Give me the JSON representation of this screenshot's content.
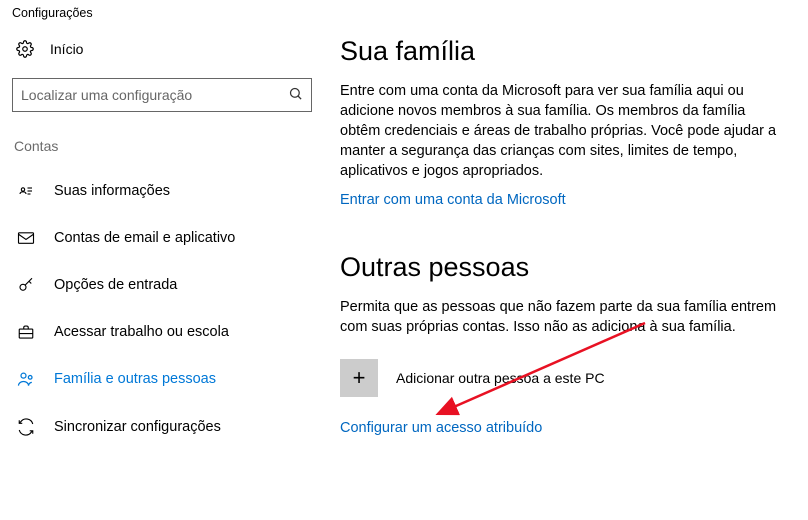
{
  "window": {
    "title": "Configurações"
  },
  "sidebar": {
    "home_label": "Início",
    "search_placeholder": "Localizar uma configuração",
    "section_label": "Contas",
    "items": [
      {
        "label": "Suas informações"
      },
      {
        "label": "Contas de email e aplicativo"
      },
      {
        "label": "Opções de entrada"
      },
      {
        "label": "Acessar trabalho ou escola"
      },
      {
        "label": "Família e outras pessoas"
      },
      {
        "label": "Sincronizar configurações"
      }
    ]
  },
  "main": {
    "family": {
      "heading": "Sua família",
      "body": "Entre com uma conta da Microsoft para ver sua família aqui ou adicione novos membros à sua família. Os membros da família obtêm credenciais e áreas de trabalho próprias. Você pode ajudar a manter a segurança das crianças com sites, limites de tempo, aplicativos e jogos apropriados.",
      "signin_link": "Entrar com uma conta da Microsoft"
    },
    "others": {
      "heading": "Outras pessoas",
      "body": "Permita que as pessoas que não fazem parte da sua família entrem com suas próprias contas. Isso não as adiciona à sua família.",
      "add_label": "Adicionar outra pessoa a este PC",
      "assigned_link": "Configurar um acesso atribuído"
    }
  }
}
